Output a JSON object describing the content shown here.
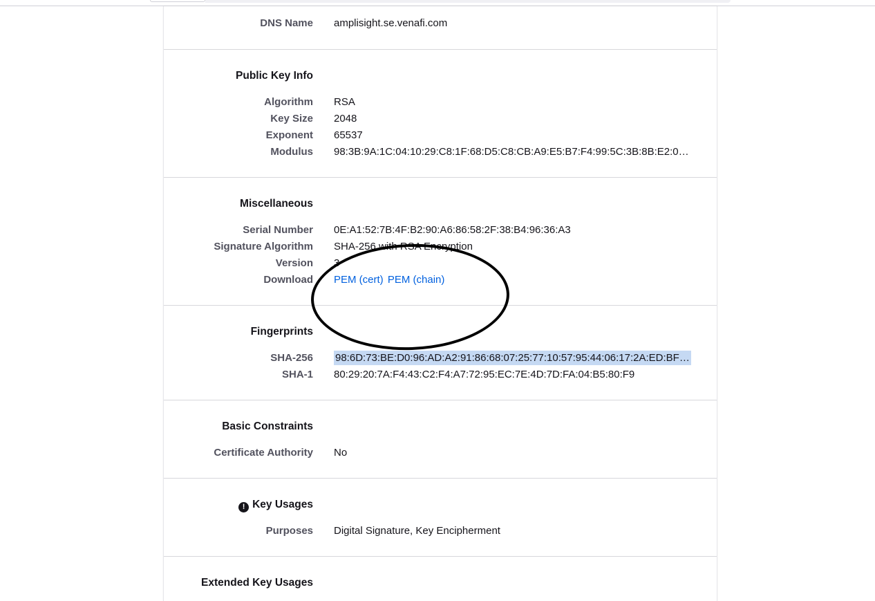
{
  "dns": {
    "label": "DNS Name",
    "value": "amplisight.se.venafi.com"
  },
  "public_key": {
    "heading": "Public Key Info",
    "rows": [
      {
        "label": "Algorithm",
        "value": "RSA"
      },
      {
        "label": "Key Size",
        "value": "2048"
      },
      {
        "label": "Exponent",
        "value": "65537"
      },
      {
        "label": "Modulus",
        "value": "98:3B:9A:1C:04:10:29:C8:1F:68:D5:C8:CB:A9:E5:B7:F4:99:5C:3B:8B:E2:0…"
      }
    ]
  },
  "misc": {
    "heading": "Miscellaneous",
    "serial": {
      "label": "Serial Number",
      "value": "0E:A1:52:7B:4F:B2:90:A6:86:58:2F:38:B4:96:36:A3"
    },
    "sig_alg": {
      "label": "Signature Algorithm",
      "value": "SHA-256 with RSA Encryption"
    },
    "version": {
      "label": "Version",
      "value": "3"
    },
    "download": {
      "label": "Download",
      "pem_cert": "PEM (cert)",
      "pem_chain": "PEM (chain)"
    }
  },
  "fingerprints": {
    "heading": "Fingerprints",
    "sha256": {
      "label": "SHA-256",
      "value": "98:6D:73:BE:D0:96:AD:A2:91:86:68:07:25:77:10:57:95:44:06:17:2A:ED:BF…"
    },
    "sha1": {
      "label": "SHA-1",
      "value": "80:29:20:7A:F4:43:C2:F4:A7:72:95:EC:7E:4D:7D:FA:04:B5:80:F9"
    }
  },
  "basic_constraints": {
    "heading": "Basic Constraints",
    "ca": {
      "label": "Certificate Authority",
      "value": "No"
    }
  },
  "key_usages": {
    "heading": "Key Usages",
    "icon": "!",
    "purposes": {
      "label": "Purposes",
      "value": "Digital Signature, Key Encipherment"
    }
  },
  "extended_key_usages": {
    "heading": "Extended Key Usages"
  }
}
